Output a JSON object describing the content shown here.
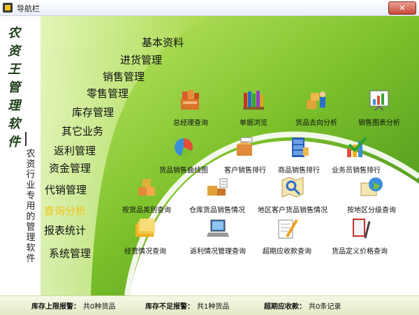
{
  "window": {
    "title": "导航栏",
    "close_glyph": "✕"
  },
  "logo": {
    "chars": [
      "农",
      "资",
      "王",
      "管",
      "理",
      "软",
      "件"
    ],
    "tagline": [
      "农",
      "资",
      "行",
      "业",
      "专",
      "用",
      "的",
      "管",
      "理",
      "软",
      "件"
    ]
  },
  "menu": [
    {
      "label": "基本资料"
    },
    {
      "label": "进货管理"
    },
    {
      "label": "销售管理"
    },
    {
      "label": "零售管理"
    },
    {
      "label": "库存管理"
    },
    {
      "label": "其它业务"
    },
    {
      "label": "返利管理"
    },
    {
      "label": "资金管理"
    },
    {
      "label": "代销管理"
    },
    {
      "label": "查询分析",
      "active": true
    },
    {
      "label": "报表统计"
    },
    {
      "label": "系统管理"
    }
  ],
  "functions": [
    {
      "label": "总经理查询",
      "icon": "books-drawer-icon"
    },
    {
      "label": "单据浏览",
      "icon": "bookshelf-icon"
    },
    {
      "label": "货品去向分析",
      "icon": "boxes-person-icon"
    },
    {
      "label": "销售图表分析",
      "icon": "chart-board-icon"
    },
    {
      "label": "货品销售曲线图",
      "icon": "pie-chart-icon"
    },
    {
      "label": "客户销售排行",
      "icon": "box-list-icon"
    },
    {
      "label": "商品销售排行",
      "icon": "cabinet-icon"
    },
    {
      "label": "业务员销售排行",
      "icon": "bar-check-icon"
    },
    {
      "label": "按货品类别查询",
      "icon": "stacked-boxes-icon"
    },
    {
      "label": "仓库货品销售情况",
      "icon": "warehouse-boxes-icon"
    },
    {
      "label": "地区客户货品销售情况",
      "icon": "map-magnifier-icon"
    },
    {
      "label": "按地区分级查询",
      "icon": "globe-map-icon"
    },
    {
      "label": "经营情况查询",
      "icon": "folder-stack-icon"
    },
    {
      "label": "返利情况管理查询",
      "icon": "laptop-icon"
    },
    {
      "label": "超期应收款查询",
      "icon": "notepad-pencil-icon"
    },
    {
      "label": "货品定义价格查询",
      "icon": "book-pen-icon"
    }
  ],
  "status": [
    {
      "label": "库存上限报警：",
      "value": "共0种货品"
    },
    {
      "label": "库存不足报警：",
      "value": "共1种货品"
    },
    {
      "label": "超期应收款：",
      "value": "共0条记录"
    }
  ],
  "colors": {
    "accent_green": "#7cc12b",
    "dark_green": "#3f8a1a",
    "active_menu": "#f5c21b",
    "status_bar": "#eef2d8"
  }
}
